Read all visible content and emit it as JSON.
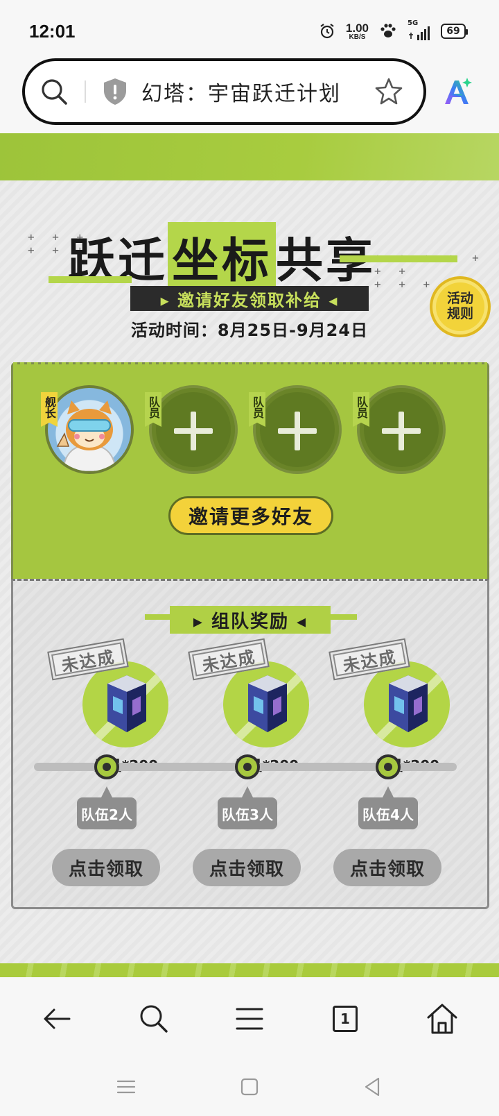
{
  "status_bar": {
    "time": "12:01",
    "net_speed_value": "1.00",
    "net_speed_unit": "KB/S",
    "signal_label": "5G",
    "battery": "69"
  },
  "browser": {
    "page_title": "幻塔：宇宙跃迁计划",
    "icons": [
      "search-icon",
      "shield-icon",
      "star-icon",
      "ai-assistant-icon"
    ]
  },
  "hero": {
    "title_part1": "跃迁",
    "title_part2": "坐标",
    "title_part3": "共享",
    "subtitle": "▸ 邀请好友领取补给 ◂",
    "activity_time": "活动时间：8月25日-9月24日",
    "rules_badge": "活动\n规则"
  },
  "team": {
    "leader_tag": "舰长",
    "member_tag": "队员",
    "invite_button": "邀请更多好友"
  },
  "rewards": {
    "title": "▸ 组队奖励 ◂",
    "stamp_text": "未达成",
    "items": [
      {
        "amount": "墨晶*200",
        "team_size": "队伍2人",
        "claim": "点击领取"
      },
      {
        "amount": "墨晶*200",
        "team_size": "队伍3人",
        "claim": "点击领取"
      },
      {
        "amount": "墨晶*200",
        "team_size": "队伍4人",
        "claim": "点击领取"
      }
    ]
  },
  "bottom_nav": {
    "tab_count": "1",
    "icons": [
      "back-icon",
      "search-icon",
      "menu-icon",
      "tabs-icon",
      "home-icon"
    ]
  },
  "colors": {
    "accent_green": "#a5c640",
    "badge_yellow": "#f3d23a",
    "dark": "#2b2b2b"
  }
}
